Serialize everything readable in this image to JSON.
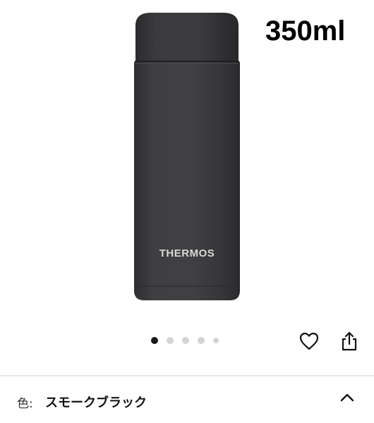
{
  "product": {
    "capacity": "350ml",
    "bottle_brand": "THERMOS",
    "bottle_color": "#3c3c3e"
  },
  "carousel": {
    "total_images": 5,
    "active_index": 0
  },
  "actions": {
    "favorite_icon": "heart-icon",
    "share_icon": "share-icon"
  },
  "color_selector": {
    "label": "色:",
    "value": "スモークブラック",
    "expanded": true
  }
}
